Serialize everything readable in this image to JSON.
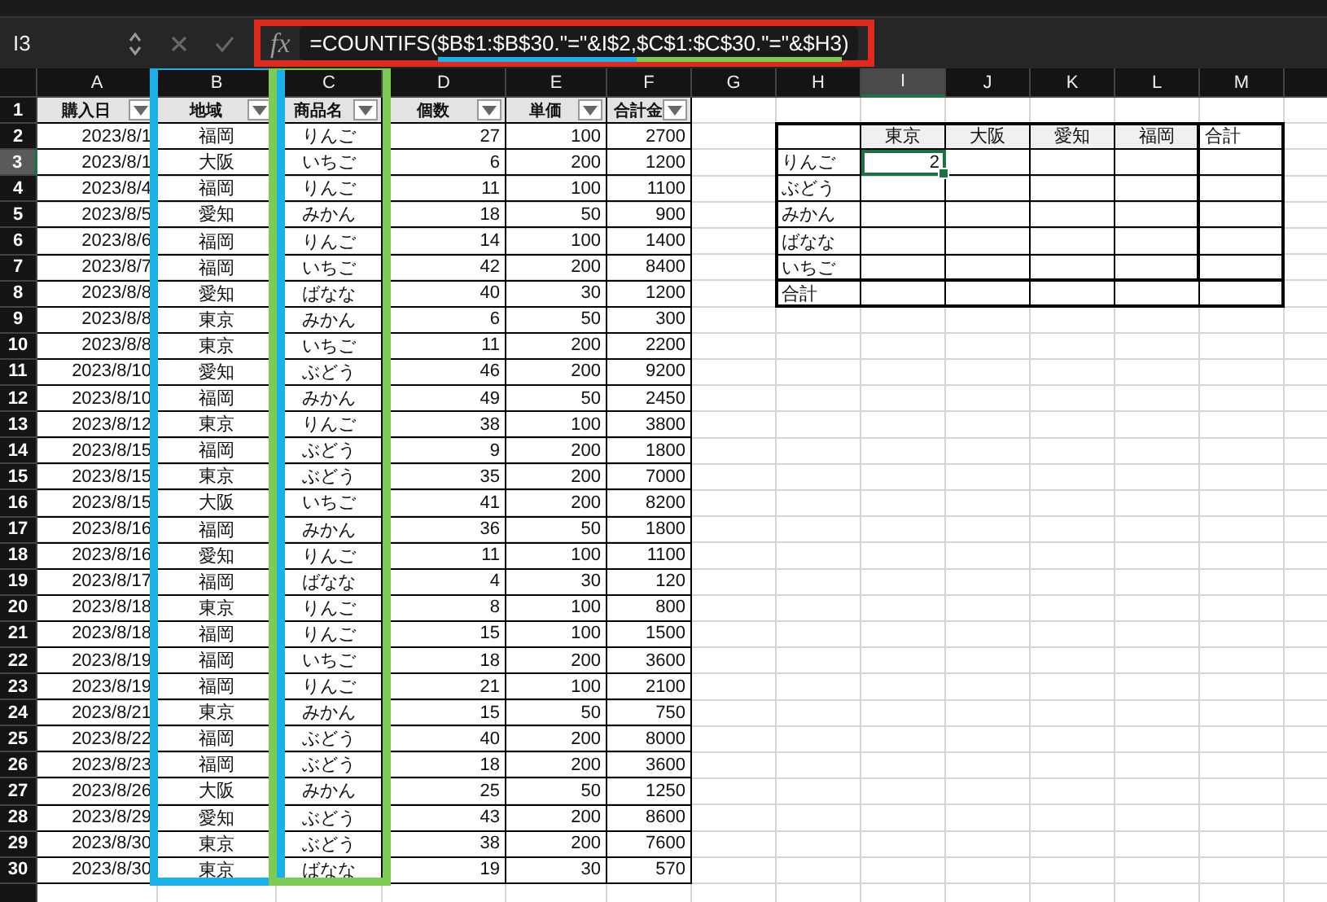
{
  "formula_bar": {
    "name_box": "I3",
    "framed": true,
    "function_label": "fx",
    "formula_parts": [
      {
        "text": "=COUNTIFS("
      },
      {
        "text": "$B$1:$B$30.\"=\"&I$2,",
        "color": "#1ab0e8"
      },
      {
        "text": "$C$1:$C$30.\"=\"&$H3",
        "color": "#7ccb55"
      },
      {
        "text": ")"
      }
    ]
  },
  "columns": [
    {
      "label": "A",
      "selected": false
    },
    {
      "label": "B",
      "selected": false,
      "color": "#1ab0e8"
    },
    {
      "label": "C",
      "selected": false,
      "color": "#7ccb55"
    },
    {
      "label": "D",
      "selected": false
    },
    {
      "label": "E",
      "selected": false
    },
    {
      "label": "F",
      "selected": false
    },
    {
      "label": "G",
      "selected": false
    },
    {
      "label": "H",
      "selected": false
    },
    {
      "label": "I",
      "selected": true
    },
    {
      "label": "J",
      "selected": false
    },
    {
      "label": "K",
      "selected": false
    },
    {
      "label": "L",
      "selected": false
    },
    {
      "label": "M",
      "selected": false
    }
  ],
  "row_headers": [
    {
      "label": "1",
      "selected": false
    },
    {
      "label": "2",
      "selected": false
    },
    {
      "label": "3",
      "selected": true
    },
    {
      "label": "4",
      "selected": false
    },
    {
      "label": "5",
      "selected": false
    },
    {
      "label": "6",
      "selected": false
    },
    {
      "label": "7",
      "selected": false
    },
    {
      "label": "8",
      "selected": false
    },
    {
      "label": "9",
      "selected": false
    },
    {
      "label": "10",
      "selected": false
    },
    {
      "label": "11",
      "selected": false
    },
    {
      "label": "12",
      "selected": false
    },
    {
      "label": "13",
      "selected": false
    },
    {
      "label": "14",
      "selected": false
    },
    {
      "label": "15",
      "selected": false
    },
    {
      "label": "16",
      "selected": false
    },
    {
      "label": "17",
      "selected": false
    },
    {
      "label": "18",
      "selected": false
    },
    {
      "label": "19",
      "selected": false
    },
    {
      "label": "20",
      "selected": false
    },
    {
      "label": "21",
      "selected": false
    },
    {
      "label": "22",
      "selected": false
    },
    {
      "label": "23",
      "selected": false
    },
    {
      "label": "24",
      "selected": false
    },
    {
      "label": "25",
      "selected": false
    },
    {
      "label": "26",
      "selected": false
    },
    {
      "label": "27",
      "selected": false
    },
    {
      "label": "28",
      "selected": false
    },
    {
      "label": "29",
      "selected": false
    },
    {
      "label": "30",
      "selected": false
    }
  ],
  "table": {
    "headers": [
      "購入日",
      "地域",
      "商品名",
      "個数",
      "単価",
      "合計金"
    ],
    "rows": [
      [
        "2023/8/1",
        "福岡",
        "りんご",
        "27",
        "100",
        "2700"
      ],
      [
        "2023/8/1",
        "大阪",
        "いちご",
        "6",
        "200",
        "1200"
      ],
      [
        "2023/8/4",
        "福岡",
        "りんご",
        "11",
        "100",
        "1100"
      ],
      [
        "2023/8/5",
        "愛知",
        "みかん",
        "18",
        "50",
        "900"
      ],
      [
        "2023/8/6",
        "福岡",
        "りんご",
        "14",
        "100",
        "1400"
      ],
      [
        "2023/8/7",
        "福岡",
        "いちご",
        "42",
        "200",
        "8400"
      ],
      [
        "2023/8/8",
        "愛知",
        "ばなな",
        "40",
        "30",
        "1200"
      ],
      [
        "2023/8/8",
        "東京",
        "みかん",
        "6",
        "50",
        "300"
      ],
      [
        "2023/8/8",
        "東京",
        "いちご",
        "11",
        "200",
        "2200"
      ],
      [
        "2023/8/10",
        "愛知",
        "ぶどう",
        "46",
        "200",
        "9200"
      ],
      [
        "2023/8/10",
        "福岡",
        "みかん",
        "49",
        "50",
        "2450"
      ],
      [
        "2023/8/12",
        "東京",
        "りんご",
        "38",
        "100",
        "3800"
      ],
      [
        "2023/8/15",
        "福岡",
        "ぶどう",
        "9",
        "200",
        "1800"
      ],
      [
        "2023/8/15",
        "東京",
        "ぶどう",
        "35",
        "200",
        "7000"
      ],
      [
        "2023/8/15",
        "大阪",
        "いちご",
        "41",
        "200",
        "8200"
      ],
      [
        "2023/8/16",
        "福岡",
        "みかん",
        "36",
        "50",
        "1800"
      ],
      [
        "2023/8/16",
        "愛知",
        "りんご",
        "11",
        "100",
        "1100"
      ],
      [
        "2023/8/17",
        "福岡",
        "ばなな",
        "4",
        "30",
        "120"
      ],
      [
        "2023/8/18",
        "東京",
        "りんご",
        "8",
        "100",
        "800"
      ],
      [
        "2023/8/18",
        "福岡",
        "りんご",
        "15",
        "100",
        "1500"
      ],
      [
        "2023/8/19",
        "福岡",
        "いちご",
        "18",
        "200",
        "3600"
      ],
      [
        "2023/8/19",
        "福岡",
        "りんご",
        "21",
        "100",
        "2100"
      ],
      [
        "2023/8/21",
        "東京",
        "みかん",
        "15",
        "50",
        "750"
      ],
      [
        "2023/8/22",
        "福岡",
        "ぶどう",
        "40",
        "200",
        "8000"
      ],
      [
        "2023/8/23",
        "福岡",
        "ぶどう",
        "18",
        "200",
        "3600"
      ],
      [
        "2023/8/26",
        "大阪",
        "みかん",
        "25",
        "50",
        "1250"
      ],
      [
        "2023/8/29",
        "愛知",
        "ぶどう",
        "43",
        "200",
        "8600"
      ],
      [
        "2023/8/30",
        "東京",
        "ぶどう",
        "38",
        "200",
        "7600"
      ],
      [
        "2023/8/30",
        "東京",
        "ばなな",
        "19",
        "30",
        "570"
      ]
    ]
  },
  "summary": {
    "columns": [
      "東京",
      "大阪",
      "愛知",
      "福岡"
    ],
    "total_column": "合計",
    "rows": [
      {
        "label": "りんご",
        "values": [
          "2"
        ]
      },
      {
        "label": "ぶどう",
        "values": []
      },
      {
        "label": "みかん",
        "values": []
      },
      {
        "label": "ばなな",
        "values": []
      },
      {
        "label": "いちご",
        "values": []
      }
    ],
    "total_row": "合計"
  }
}
